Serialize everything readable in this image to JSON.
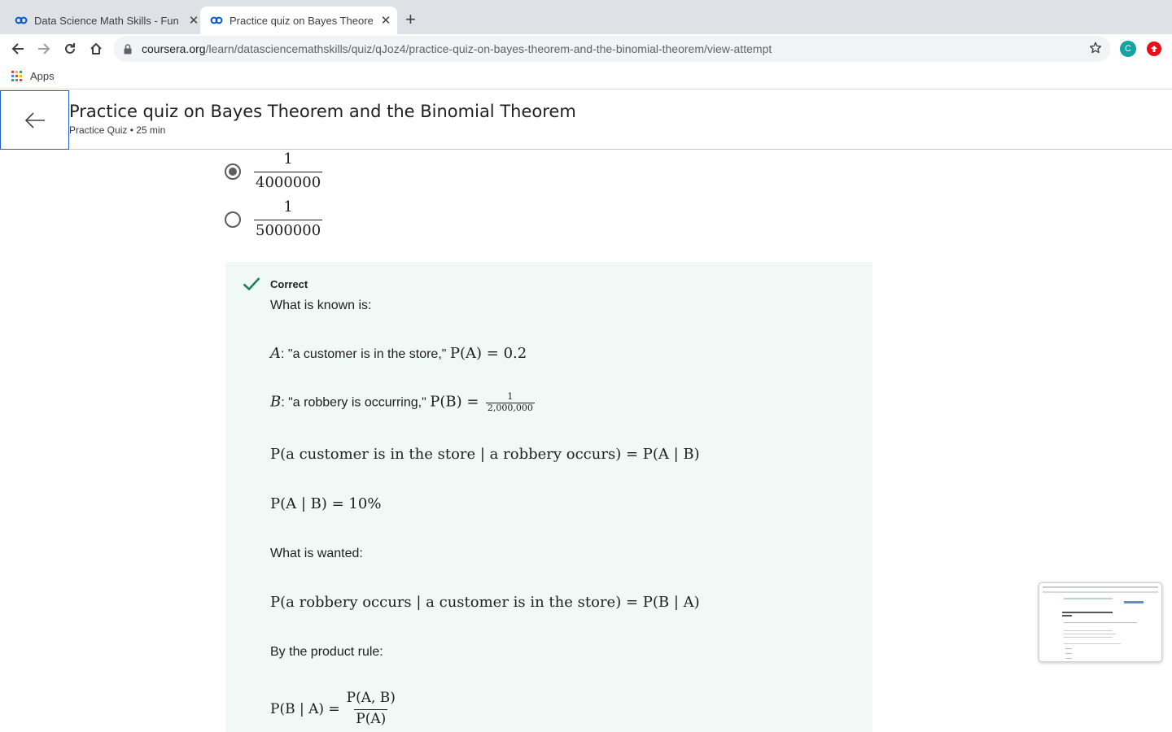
{
  "browser": {
    "tabs": [
      {
        "title": "Data Science Math Skills - Fun",
        "active": false
      },
      {
        "title": "Practice quiz on Bayes Theorem",
        "active": true
      }
    ],
    "url_host": "coursera.org",
    "url_path": "/learn/datasciencemathskills/quiz/qJoz4/practice-quiz-on-bayes-theorem-and-the-binomial-theorem/view-attempt",
    "profile_initial": "C",
    "bookmarks": {
      "apps_label": "Apps"
    }
  },
  "header": {
    "title": "Practice quiz on Bayes Theorem and the Binomial Theorem",
    "meta": "Practice Quiz • 25 min"
  },
  "options": [
    {
      "numerator": "1",
      "denominator": "4000000",
      "selected": true
    },
    {
      "numerator": "1",
      "denominator": "5000000",
      "selected": false
    }
  ],
  "feedback": {
    "status": "Correct",
    "known_label": "What is known is:",
    "a_text": ": \"a customer is in the store,\" ",
    "a_math": "P(A) = 0.2",
    "b_text": ": \"a robbery is occurring,\" ",
    "b_math": "P(B) =",
    "b_frac_num": "1",
    "b_frac_den": "2,000,000",
    "cond1": "P(a customer is in the store | a robbery occurs) = P(A | B)",
    "cond2_math": "P(A | B)",
    "cond2_rest": " = 10%",
    "wanted_label": "What is wanted:",
    "wanted_math": "P(a robbery occurs | a customer is in the store) = P(B | A)",
    "product_rule_label": "By the product rule:",
    "final_lhs": "P(B | A) =",
    "final_num": "P(A, B)",
    "final_den": "P(A)"
  },
  "colors": {
    "feedback_bg": "#f0f9f6",
    "check": "#1f8354",
    "accent_blue": "#1f5ecb",
    "profile_teal": "#12a4a1",
    "extension_red": "#e3101a"
  }
}
